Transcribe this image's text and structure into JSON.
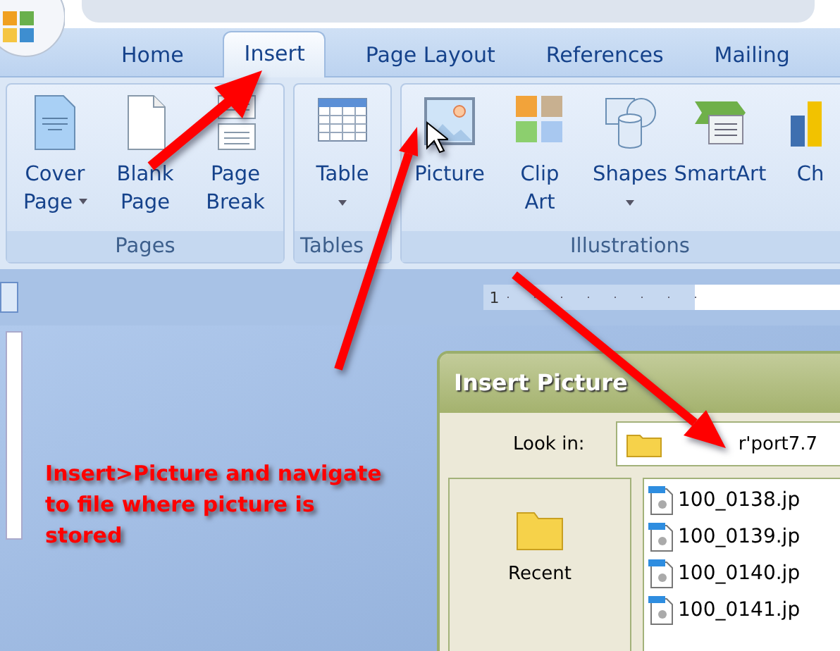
{
  "tabs": [
    {
      "label": "Home",
      "selected": false
    },
    {
      "label": "Insert",
      "selected": true
    },
    {
      "label": "Page Layout",
      "selected": false
    },
    {
      "label": "References",
      "selected": false
    },
    {
      "label": "Mailing",
      "selected": false
    }
  ],
  "ribbon": {
    "groups": [
      {
        "label": "Pages",
        "buttons": [
          {
            "kind": "cover",
            "lines": [
              "Cover",
              "Page"
            ],
            "dropdown": true
          },
          {
            "kind": "blank",
            "lines": [
              "Blank",
              "Page"
            ],
            "dropdown": false
          },
          {
            "kind": "break",
            "lines": [
              "Page",
              "Break"
            ],
            "dropdown": false
          }
        ]
      },
      {
        "label": "Tables",
        "buttons": [
          {
            "kind": "table",
            "lines": [
              "Table"
            ],
            "dropdown": true
          }
        ]
      },
      {
        "label": "Illustrations",
        "buttons": [
          {
            "kind": "picture",
            "lines": [
              "Picture"
            ],
            "dropdown": false
          },
          {
            "kind": "clipart",
            "lines": [
              "Clip",
              "Art"
            ],
            "dropdown": false
          },
          {
            "kind": "shapes",
            "lines": [
              "Shapes"
            ],
            "dropdown": true
          },
          {
            "kind": "smartart",
            "lines": [
              "SmartArt"
            ],
            "dropdown": false
          },
          {
            "kind": "chart",
            "lines": [
              "Ch"
            ],
            "dropdown": false
          }
        ]
      }
    ]
  },
  "ruler": {
    "mark": "1"
  },
  "annotation": "Insert>Picture and navigate to file where picture is stored",
  "dialog": {
    "title": "Insert Picture",
    "look_in_label": "Look in:",
    "look_in_value": "r'port7.7",
    "places": [
      {
        "label": "Recent"
      }
    ],
    "files": [
      "100_0138.jp",
      "100_0139.jp",
      "100_0140.jp",
      "100_0141.jp"
    ]
  }
}
